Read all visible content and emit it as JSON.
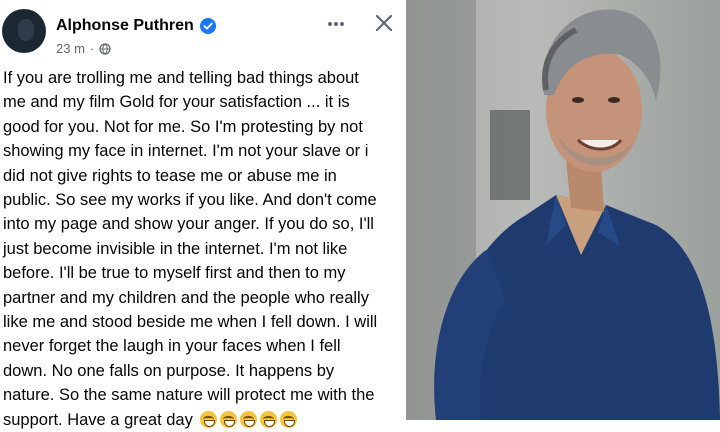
{
  "post": {
    "author": "Alphonse Puthren",
    "time": "23 m",
    "dot": "·",
    "lines": [
      "If you are trolling me and telling bad things about",
      "me and my film Gold for your satisfaction ... it is",
      "good for you. Not for me. So I'm protesting by not",
      "showing my face in internet. I'm not your slave or i",
      "did not give rights to tease me or abuse me in",
      "public. So see my works if you like. And don't come",
      "into my page and show your anger. If you do so, I'll",
      "just become invisible in the internet. I'm not like",
      "before. I'll be true to myself first and then to my",
      "partner and my children and the people who really",
      "like me and stood beside me when I fell down. I will",
      "never forget the laugh in your faces when I fell",
      "down. No one falls on purpose. It happens by",
      "nature. So the same nature will protect me with the",
      "support. Have a great day"
    ],
    "icons": {
      "verified": "verified-badge-icon",
      "globe": "globe-icon",
      "more": "more-options-icon",
      "close": "close-icon",
      "emoji": "grinning-face-emoji"
    },
    "colors": {
      "verified": "#1877f2",
      "meta": "#65676b",
      "text": "#050505"
    }
  },
  "photo": {
    "subject": "portrait-photo"
  }
}
